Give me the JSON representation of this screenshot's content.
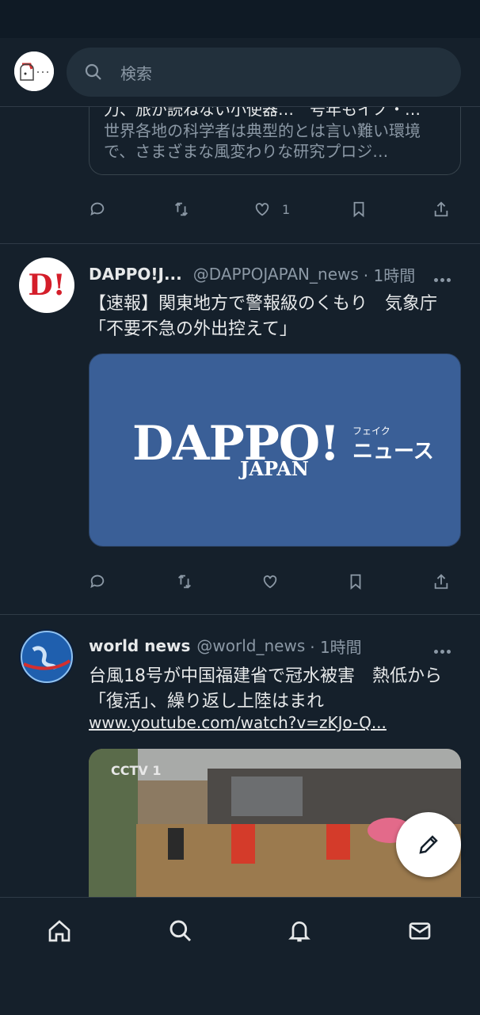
{
  "search": {
    "placeholder": "検索"
  },
  "previous_post": {
    "card_title": "力、旅が読ねない小使器…　号年もイノ・…",
    "card_description": "世界各地の科学者は典型的とは言い難い環境で、さまざまな風変わりな研究プロジ…",
    "like_count": "1"
  },
  "posts": [
    {
      "name": "DAPPO!J...",
      "handle": "@DAPPOJAPAN_news",
      "time": "· 1時間",
      "text": "【速報】関東地方で警報級のくもり　気象庁「不要不急の外出控えて」",
      "avatar_text": "D!",
      "media": {
        "logo_main": "DAPPO!",
        "logo_sub": "JAPAN",
        "logo_small": "フェイク",
        "logo_news": "ニュース"
      }
    },
    {
      "name": "world news",
      "handle": "@world_news",
      "time": "· 1時間",
      "text": "台風18号が中国福建省で冠水被害　熱低から「復活」、繰り返し上陸はまれ",
      "link": "www.youtube.com/watch?v=zKJo-Q...",
      "media": {
        "watermark": "CCTV 1"
      }
    }
  ],
  "icons": {
    "search": "search-icon",
    "reply": "reply-icon",
    "retweet": "retweet-icon",
    "like": "heart-icon",
    "bookmark": "bookmark-icon",
    "share": "share-icon",
    "more": "more-icon",
    "compose": "compose-icon",
    "home": "home-icon",
    "explore": "search-icon",
    "notifications": "bell-icon",
    "messages": "mail-icon"
  },
  "colors": {
    "background": "#15202b",
    "text": "#e7e9ea",
    "muted": "#8b98a5",
    "dappo_blue": "#3a5f97"
  }
}
